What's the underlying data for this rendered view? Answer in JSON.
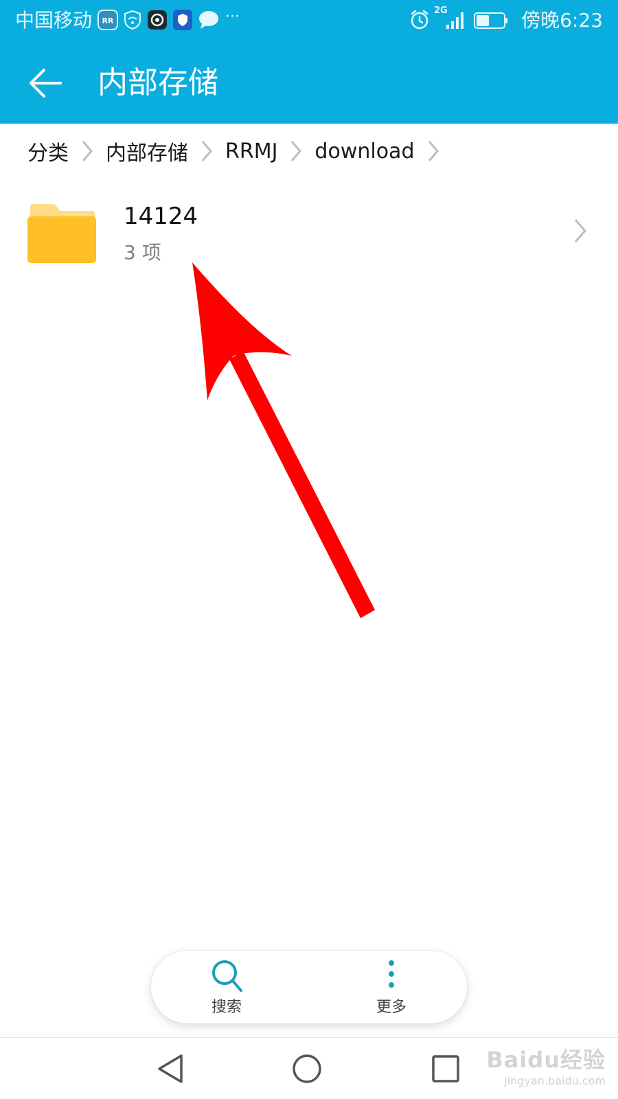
{
  "status_bar": {
    "carrier": "中国移动",
    "network_label": "2G",
    "time": "傍晚6:23",
    "icons": [
      "rr-app-icon",
      "wifi-shield-icon",
      "camera-app-icon",
      "shield-icon",
      "chat-bubble-icon",
      "more-dots-icon",
      "alarm-icon",
      "signal-icon",
      "battery-icon"
    ]
  },
  "app_bar": {
    "title": "内部存储",
    "back_icon": "arrow-left-icon"
  },
  "breadcrumb": [
    "分类",
    "内部存储",
    "RRMJ",
    "download"
  ],
  "files": [
    {
      "name": "14124",
      "meta": "3 项",
      "icon": "folder-icon"
    }
  ],
  "toolbar": {
    "search_label": "搜索",
    "more_label": "更多"
  },
  "colors": {
    "accent": "#0aaede",
    "folder": "#ffbf26",
    "folder_tab": "#ffdc8a",
    "annotation": "#ff0000",
    "toolbar_icon": "#1a9fb8"
  },
  "watermark": {
    "logo": "Baidu经验",
    "url": "jingyan.baidu.com"
  }
}
